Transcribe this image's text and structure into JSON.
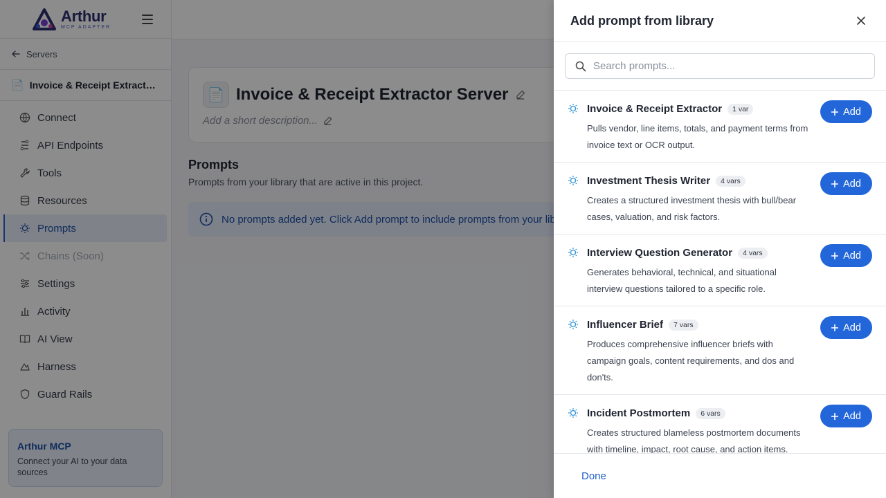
{
  "brand": {
    "name": "Arthur",
    "subtitle": "MCP ADAPTER"
  },
  "sidebar": {
    "back_label": "Servers",
    "server_name": "Invoice & Receipt Extractor Server",
    "nav": [
      {
        "label": "Connect",
        "icon": "globe-icon"
      },
      {
        "label": "API Endpoints",
        "icon": "api-icon"
      },
      {
        "label": "Tools",
        "icon": "wrench-icon"
      },
      {
        "label": "Resources",
        "icon": "database-icon"
      },
      {
        "label": "Prompts",
        "icon": "lightbulb-icon",
        "active": true
      },
      {
        "label": "Chains (Soon)",
        "icon": "shuffle-icon",
        "disabled": true
      },
      {
        "label": "Settings",
        "icon": "sliders-icon"
      },
      {
        "label": "Activity",
        "icon": "bar-chart-icon"
      },
      {
        "label": "AI View",
        "icon": "book-icon"
      },
      {
        "label": "Harness",
        "icon": "harness-icon"
      },
      {
        "label": "Guard Rails",
        "icon": "shield-icon"
      }
    ],
    "promo": {
      "title": "Arthur MCP",
      "text": "Connect your AI to your data sources"
    }
  },
  "main": {
    "server_title": "Invoice & Receipt Extractor Server",
    "description_placeholder": "Add a short description...",
    "section_title": "Prompts",
    "section_subtitle": "Prompts from your library that are active in this project.",
    "info_text": "No prompts added yet. Click Add prompt to include prompts from your library."
  },
  "drawer": {
    "title": "Add prompt from library",
    "search_placeholder": "Search prompts...",
    "add_label": "Add",
    "done_label": "Done",
    "items": [
      {
        "title": "Invoice & Receipt Extractor",
        "badge": "1 var",
        "description": "Pulls vendor, line items, totals, and payment terms from invoice text or OCR output."
      },
      {
        "title": "Investment Thesis Writer",
        "badge": "4 vars",
        "description": "Creates a structured investment thesis with bull/bear cases, valuation, and risk factors."
      },
      {
        "title": "Interview Question Generator",
        "badge": "4 vars",
        "description": "Generates behavioral, technical, and situational interview questions tailored to a specific role."
      },
      {
        "title": "Influencer Brief",
        "badge": "7 vars",
        "description": "Produces comprehensive influencer briefs with campaign goals, content requirements, and dos and don'ts."
      },
      {
        "title": "Incident Postmortem",
        "badge": "6 vars",
        "description": "Creates structured blameless postmortem documents with timeline, impact, root cause, and action items."
      }
    ]
  },
  "colors": {
    "accent": "#2266d9",
    "active_nav_bg": "#e7edf8",
    "overlay": "rgba(0,0,0,0.45)"
  }
}
